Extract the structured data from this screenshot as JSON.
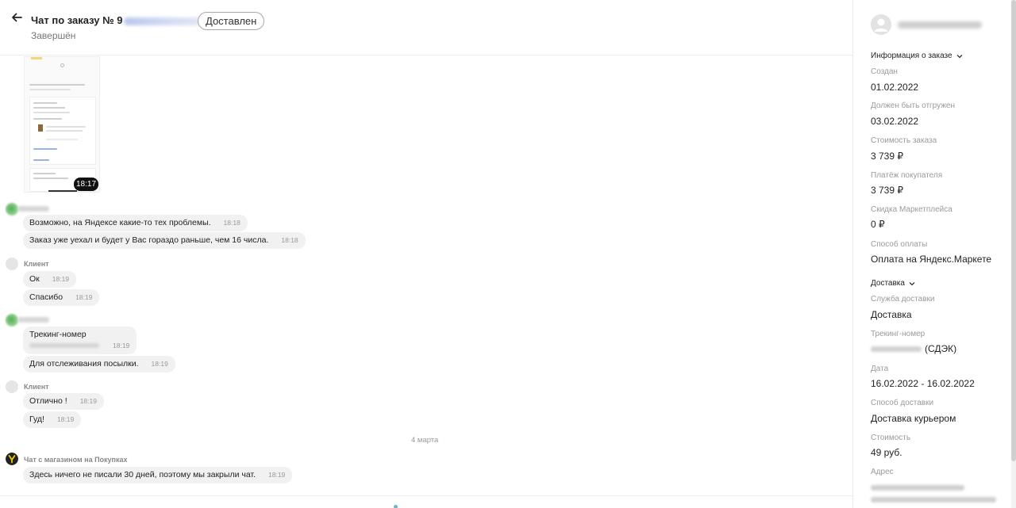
{
  "header": {
    "title_prefix": "Чат по заказу № 9",
    "status_pill": "Доставлен",
    "subtitle": "Завершён"
  },
  "chat": {
    "screenshot_time": "18:17",
    "messages": [
      {
        "text": "Возможно, на Яндексе какие-то тех проблемы.",
        "time": "18:18"
      },
      {
        "text": "Заказ уже уехал и будет у Вас гораздо раньше, чем 16 числа.",
        "time": "18:18"
      },
      {
        "text": "Ок",
        "time": "18:19"
      },
      {
        "text": "Спасибо",
        "time": "18:19"
      },
      {
        "text": "Трекинг-номер",
        "time": "18:19"
      },
      {
        "text": "Для отслеживания посылки.",
        "time": "18:19"
      },
      {
        "text": "Отлично !",
        "time": "18:19"
      },
      {
        "text": "Гуд!",
        "time": "18:19"
      },
      {
        "text": "Здесь ничего не писали 30 дней, поэтому мы закрыли чат.",
        "time": "18:19"
      }
    ],
    "senders": {
      "client": "Клиент",
      "system": "Чат с магазином на Покупках"
    },
    "date_separator": "4 марта"
  },
  "panel": {
    "order_section": "Информация о заказе",
    "delivery_section": "Доставка",
    "fields": {
      "created_label": "Создан",
      "created_value": "01.02.2022",
      "ship_label": "Должен быть отгружен",
      "ship_value": "03.02.2022",
      "cost_label": "Стоимость заказа",
      "cost_value": "3 739 ₽",
      "payment_label": "Платёж покупателя",
      "payment_value": "3 739 ₽",
      "discount_label": "Скидка Маркетплейса",
      "discount_value": "0 ₽",
      "pay_method_label": "Способ оплаты",
      "pay_method_value": "Оплата на Яндекс.Маркете",
      "service_label": "Служба доставки",
      "service_value": "Доставка",
      "tracking_label": "Трекинг-номер",
      "tracking_value": "(СДЭК)",
      "date_label": "Дата",
      "date_value": "16.02.2022 - 16.02.2022",
      "delivery_method_label": "Способ доставки",
      "delivery_method_value": "Доставка курьером",
      "delivery_cost_label": "Стоимость",
      "delivery_cost_value": "49 руб.",
      "address_label": "Адрес"
    }
  },
  "icons": {
    "back": "arrow-left-icon",
    "chevron": "chevron-down-icon"
  },
  "colors": {
    "bubble": "#f1f1f1",
    "time_chip": "#111111",
    "muted_text": "#9a9a9a"
  }
}
